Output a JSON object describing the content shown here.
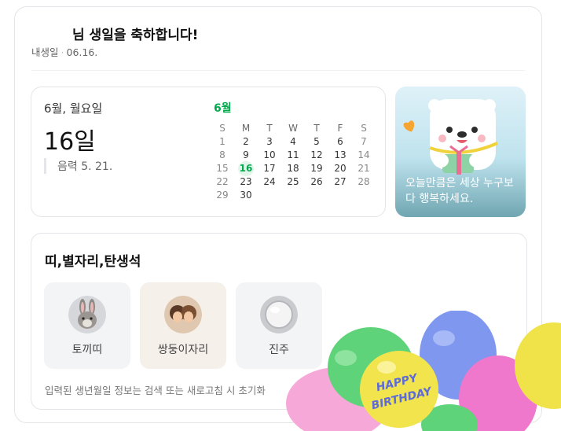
{
  "birthday": {
    "title": "님 생일을 축하합니다!",
    "label": "내생일",
    "separator": "·",
    "date": "06.16."
  },
  "calendar": {
    "header": "6월, 월요일",
    "day": "16일",
    "lunar": "음력 5. 21.",
    "month_label": "6월",
    "weekdays": [
      "S",
      "M",
      "T",
      "W",
      "T",
      "F",
      "S"
    ],
    "weeks": [
      [
        "1",
        "2",
        "3",
        "4",
        "5",
        "6",
        "7"
      ],
      [
        "8",
        "9",
        "10",
        "11",
        "12",
        "13",
        "14"
      ],
      [
        "15",
        "16",
        "17",
        "18",
        "19",
        "20",
        "21"
      ],
      [
        "22",
        "23",
        "24",
        "25",
        "26",
        "27",
        "28"
      ],
      [
        "29",
        "30",
        "",
        "",
        "",
        "",
        ""
      ]
    ],
    "today": "16"
  },
  "promo": {
    "message": "오늘만큼은 세상 누구보다 행복하세요."
  },
  "zodiac": {
    "title": "띠,별자리,탄생석",
    "items": [
      {
        "label": "토끼띠",
        "icon": "rabbit-icon"
      },
      {
        "label": "쌍둥이자리",
        "icon": "gemini-twins-icon"
      },
      {
        "label": "진주",
        "icon": "pearl-icon"
      }
    ],
    "note": "입력된 생년월일 정보는 검색 또는 새로고침 시 초기화"
  },
  "decoration": {
    "balloon_text_1": "HAPPY",
    "balloon_text_2": "BIRTHDAY"
  },
  "colors": {
    "accent_green": "#03a94d",
    "today_bg": "#e2f5ea"
  }
}
